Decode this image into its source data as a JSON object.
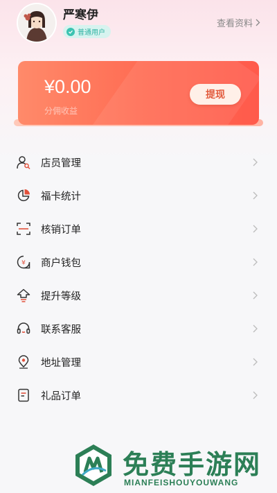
{
  "header": {
    "username": "严寒伊",
    "badge": "普通用户",
    "profile_link": "查看资料"
  },
  "earnings": {
    "amount": "¥0.00",
    "label": "分佣收益",
    "withdraw": "提现"
  },
  "menu": [
    {
      "label": "店员管理",
      "icon": "staff-icon"
    },
    {
      "label": "福卡统计",
      "icon": "pie-chart-icon"
    },
    {
      "label": "核销订单",
      "icon": "scan-icon"
    },
    {
      "label": "商户钱包",
      "icon": "wallet-icon"
    },
    {
      "label": "提升等级",
      "icon": "upgrade-icon"
    },
    {
      "label": "联系客服",
      "icon": "headset-icon"
    },
    {
      "label": "地址管理",
      "icon": "location-icon"
    },
    {
      "label": "礼品订单",
      "icon": "gift-order-icon"
    }
  ],
  "watermark": {
    "title": "免费手游网",
    "subtitle": "MIANFEISHOUYOUWANG"
  },
  "colors": {
    "accent": "#ff6d54",
    "badge": "#3cc3b1",
    "watermark": "#2c7f56"
  }
}
